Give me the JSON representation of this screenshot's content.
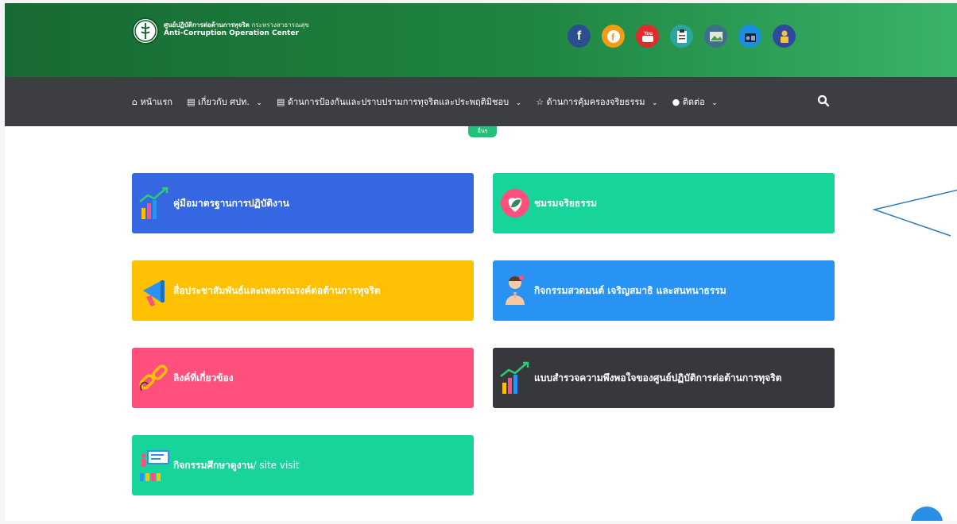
{
  "header": {
    "org_name_th": "ศูนย์ปฏิบัติการต่อต้านการทุจริต",
    "ministry_th": "กระทรวงสาธารณสุข",
    "org_name_en": "Anti-Corruption Operation Center"
  },
  "social": [
    {
      "icon": "facebook-icon",
      "glyph": "f",
      "color": "#2b4f8e"
    },
    {
      "icon": "facebook-alt-icon",
      "glyph": "f",
      "color": "#f39c12"
    },
    {
      "icon": "youtube-icon",
      "glyph": "You",
      "color": "#e02b2b"
    },
    {
      "icon": "clipboard-icon",
      "glyph": "",
      "color": "#2aa6a0"
    },
    {
      "icon": "gallery-icon",
      "glyph": "",
      "color": "#3f6f8a"
    },
    {
      "icon": "radio-icon",
      "glyph": "",
      "color": "#1a8fe0"
    },
    {
      "icon": "lock-person-icon",
      "glyph": "",
      "color": "#2f4a9a"
    }
  ],
  "nav": {
    "home": "หน้าแรก",
    "about": "เกี่ยวกับ ศปท.",
    "prevention": "ด้านการป้องกันและปราบปรามการทุจริตและประพฤติมิชอบ",
    "ethics": "ด้านการคุ้มครองจริยธรรม",
    "contact": "ติดต่อ"
  },
  "more_tag": "อื่นๆ",
  "cards": [
    {
      "label": "คู่มือมาตรฐานการปฏิบัติงาน",
      "color": "#3567e3",
      "icon": "growth-chart-icon"
    },
    {
      "label": "ชมรมจริยธรรม",
      "color": "#17d49b",
      "icon": "heart-leaf-icon"
    },
    {
      "label": "สื่อประชาสัมพันธ์และเพลงรณรงค์ต่อต้านการทุจริต",
      "color": "#fdc002",
      "icon": "megaphone-icon"
    },
    {
      "label": "กิจกรรมสวดมนต์ เจริญสมาธิ และสนทนาธรรม",
      "color": "#2893f3",
      "icon": "praying-person-icon"
    },
    {
      "label": "ลิงค์ที่เกี่ยวข้อง",
      "color": "#fe4f7d",
      "icon": "chain-link-icon"
    },
    {
      "label": "แบบสำรวจความพึงพอใจของศูนย์ปฏิบัติการต่อต้านการทุจริต",
      "color": "#37383d",
      "icon": "growth-chart-icon"
    },
    {
      "label": "กิจกรรมศึกษาดูงาน",
      "label_suffix": " / site visit",
      "color": "#17d49b",
      "icon": "presentation-icon"
    }
  ]
}
